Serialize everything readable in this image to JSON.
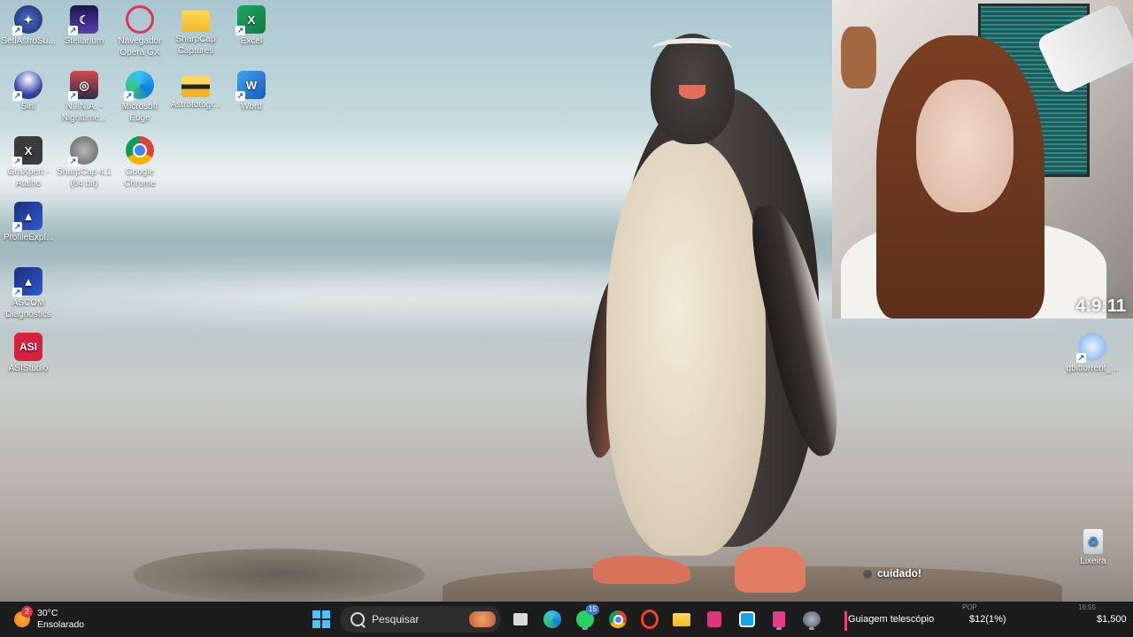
{
  "desktop": {
    "icons": [
      {
        "label": "SetiAstroSu...",
        "icon": "setiastro-icon"
      },
      {
        "label": "Stellarium",
        "icon": "stellarium-icon"
      },
      {
        "label": "Navegador Opera GX",
        "icon": "opera-gx-icon"
      },
      {
        "label": "SharpCap Captures",
        "icon": "folder-icon"
      },
      {
        "label": "Excel",
        "icon": "excel-icon"
      },
      {
        "label": "Siril",
        "icon": "siril-icon"
      },
      {
        "label": "N.I.N.A. - Nighttime...",
        "icon": "nina-icon"
      },
      {
        "label": "Microsoft Edge",
        "icon": "edge-icon"
      },
      {
        "label": "Astrofotogr...",
        "icon": "folder-icon"
      },
      {
        "label": "Word",
        "icon": "word-icon"
      },
      {
        "label": "GraXpert - Atalho",
        "icon": "graxpert-icon"
      },
      {
        "label": "SharpCap 4.1 (64 bit)",
        "icon": "sharpcap-icon"
      },
      {
        "label": "Google Chrome",
        "icon": "chrome-icon"
      },
      {
        "label": "ProfileExpl...",
        "icon": "ascom-profile-icon"
      },
      {
        "label": "ASCOM Diagnostics",
        "icon": "ascom-diagnostics-icon"
      },
      {
        "label": "ASIStudio",
        "icon": "asistudio-icon"
      },
      {
        "label": "qbittorrent_...",
        "icon": "qbittorrent-icon"
      },
      {
        "label": "Lixeira",
        "icon": "recycle-bin-icon"
      }
    ],
    "asi_badge": "ASI",
    "caption": "cuidado!"
  },
  "webcam": {
    "clock_overlay": "4:9:11"
  },
  "taskbar": {
    "weather_temp": "30°C",
    "weather_desc": "Ensolarado",
    "weather_badge": "2",
    "search_placeholder": "Pesquisar",
    "whatsapp_badge": "15",
    "pinned": [
      "start-button",
      "search",
      "file-explorer-app",
      "edge-app",
      "whatsapp-app",
      "chrome-app",
      "opera-gx-app",
      "folder-app",
      "notion-app",
      "app-cyan",
      "app-pink",
      "sharpcap-app"
    ],
    "ticker_title": "Guiagem telescópio",
    "ticker_amount": "$12(1%)",
    "ticker_total": "$1,500",
    "ticker_faded_1": "POP",
    "ticker_faded_2": "16:55"
  },
  "colors": {
    "taskbar_bg": "#1c1c1c",
    "ticker_accent": "#e0487a",
    "asi_red": "#d8213f"
  }
}
